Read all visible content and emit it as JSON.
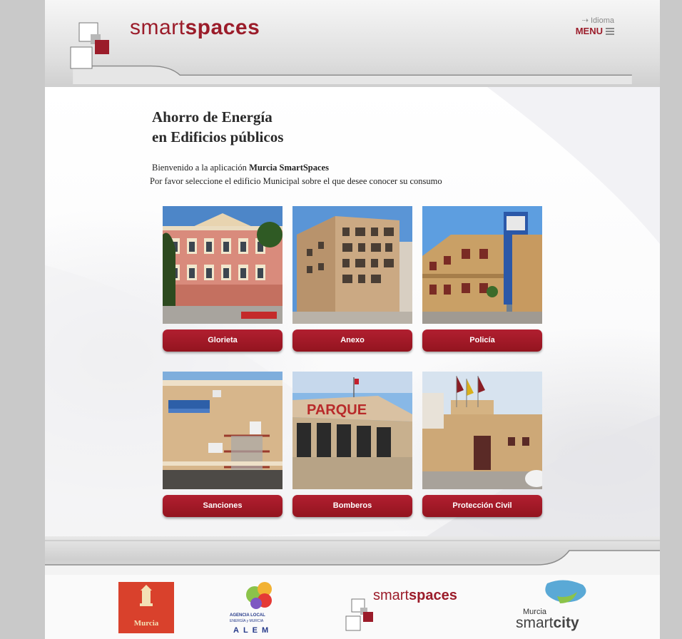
{
  "header": {
    "logo": {
      "light": "smart",
      "bold": "spaces"
    },
    "idioma_label": "Idioma",
    "menu_label": "MENU"
  },
  "main": {
    "title_line1": "Ahorro de Energía",
    "title_line2": "en Edificios públicos",
    "intro_prefix": "Bienvenido a la aplicación",
    "intro_app_name": "Murcia SmartSpaces",
    "intro_line2": "Por favor seleccione el edificio Municipal sobre el que desee conocer su consumo",
    "buildings": [
      {
        "label": "Glorieta",
        "photo": "glorieta-building-photo"
      },
      {
        "label": "Anexo",
        "photo": "anexo-building-photo"
      },
      {
        "label": "Policía",
        "photo": "policia-building-photo"
      },
      {
        "label": "Sanciones",
        "photo": "sanciones-building-photo"
      },
      {
        "label": "Bomberos",
        "photo": "bomberos-building-photo"
      },
      {
        "label": "Protección Civil",
        "photo": "proteccion-civil-building-photo"
      }
    ]
  },
  "footer": {
    "murcia_logo_text": "Murcia",
    "alem_line1": "AGENCIA LOCAL",
    "alem_line2": "ENERGÍA y MURCIA",
    "alem_line3": "ALEM",
    "smartspaces": {
      "light": "smart",
      "bold": "spaces"
    },
    "smartcity": {
      "top": "Murcia",
      "light": "smart",
      "bold": "city"
    }
  },
  "colors": {
    "brand_red": "#9b1c2a",
    "button_red": "#a81a2b",
    "page_bg": "#ededed",
    "outer_bg": "#c9c9c9"
  }
}
